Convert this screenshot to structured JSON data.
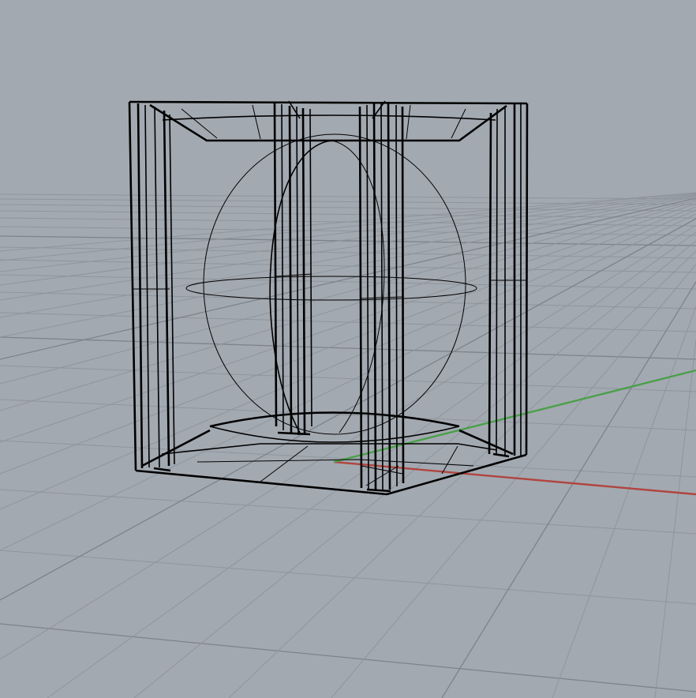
{
  "viewport": {
    "background_color": "#a3a9b1",
    "grid_minor_color": "#8f959d",
    "grid_major_color": "#7d838b",
    "axis_colors": {
      "x_axis": "#b0453f",
      "y_axis": "#4aa04a"
    },
    "wireframe_color": "#000000",
    "display_mode": "wireframe",
    "objects": [
      {
        "name": "box-frame-object",
        "shape": "hollow-box"
      },
      {
        "name": "sphere-object",
        "shape": "sphere"
      },
      {
        "name": "center-column-object",
        "shape": "column"
      }
    ]
  }
}
